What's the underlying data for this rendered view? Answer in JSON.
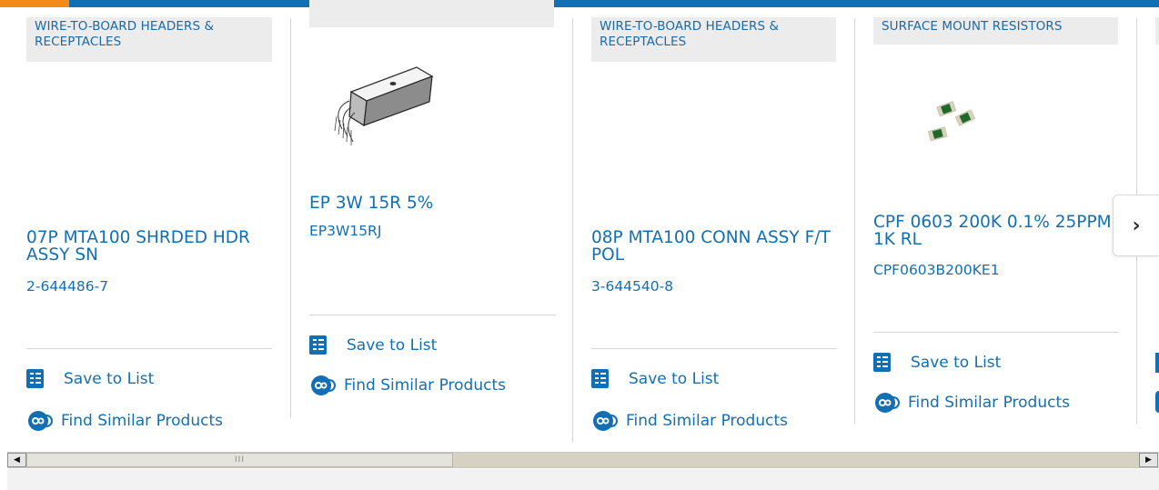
{
  "colors": {
    "accent": "#136fb3",
    "top_accent": "#f28a1c",
    "category_bg": "#ececec"
  },
  "cards": [
    {
      "category": "WIRE-TO-BOARD HEADERS & RECEPTACLES",
      "title": "07P MTA100 SHRDED HDR ASSY SN",
      "part_number": "2-644486-7",
      "save_label": "Save to List",
      "find_label": "Find Similar Products"
    },
    {
      "category": "",
      "title": "EP 3W 15R 5%",
      "part_number": "EP3W15RJ",
      "save_label": "Save to List",
      "find_label": "Find Similar Products"
    },
    {
      "category": "WIRE-TO-BOARD HEADERS & RECEPTACLES",
      "title": "08P MTA100 CONN ASSY F/T POL",
      "part_number": "3-644540-8",
      "save_label": "Save to List",
      "find_label": "Find Similar Products"
    },
    {
      "category": "SURFACE MOUNT RESISTORS",
      "title": "CPF 0603 200K 0.1% 25PPM 1K RL",
      "part_number": "CPF0603B200KE1",
      "save_label": "Save to List",
      "find_label": "Find Similar Products"
    }
  ],
  "carousel": {
    "next_icon": "chevron-right-icon",
    "next_glyph": "›"
  },
  "scrollbar": {
    "left_glyph": "◀",
    "right_glyph": "▶",
    "thumb_grip": "III"
  }
}
